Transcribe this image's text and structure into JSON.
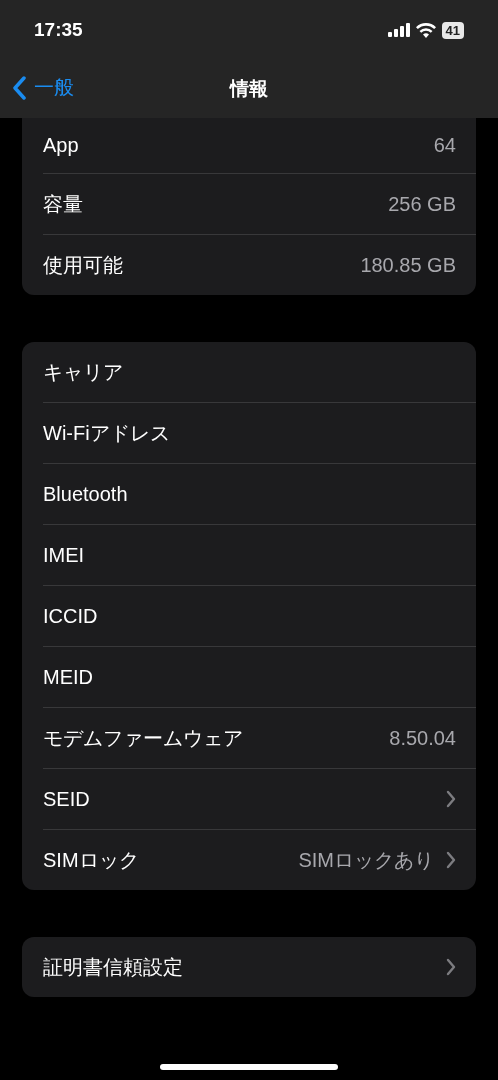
{
  "status_bar": {
    "time": "17:35",
    "battery": "41"
  },
  "nav": {
    "back": "一般",
    "title": "情報"
  },
  "groups": [
    {
      "rows": [
        {
          "label": "App",
          "value": "64",
          "chevron": false
        },
        {
          "label": "容量",
          "value": "256 GB",
          "chevron": false
        },
        {
          "label": "使用可能",
          "value": "180.85 GB",
          "chevron": false
        }
      ]
    },
    {
      "rows": [
        {
          "label": "キャリア",
          "chevron": false
        },
        {
          "label": "Wi-Fiアドレス",
          "chevron": false
        },
        {
          "label": "Bluetooth",
          "chevron": false
        },
        {
          "label": "IMEI",
          "chevron": false
        },
        {
          "label": "ICCID",
          "chevron": false
        },
        {
          "label": "MEID",
          "chevron": false
        },
        {
          "label": "モデムファームウェア",
          "value": "8.50.04",
          "chevron": false
        },
        {
          "label": "SEID",
          "chevron": true
        },
        {
          "label": "SIMロック",
          "value": "SIMロックあり",
          "chevron": true
        }
      ]
    },
    {
      "rows": [
        {
          "label": "証明書信頼設定",
          "chevron": true
        }
      ]
    }
  ]
}
